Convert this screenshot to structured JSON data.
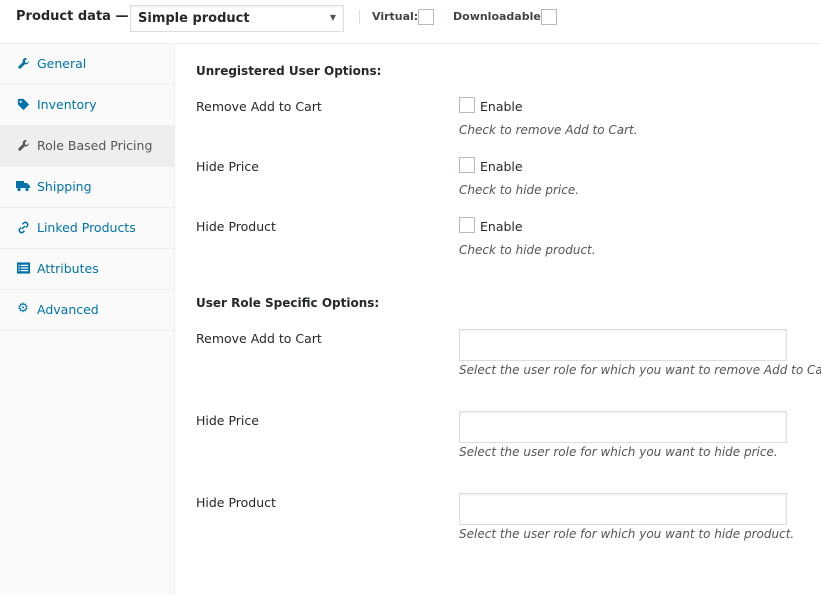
{
  "header": {
    "title": "Product data —",
    "product_type": "Simple product",
    "virtual_label": "Virtual:",
    "downloadable_label": "Downloadable:"
  },
  "sidebar": {
    "items": [
      {
        "label": "General",
        "icon": "wrench-icon"
      },
      {
        "label": "Inventory",
        "icon": "tag-icon"
      },
      {
        "label": "Role Based Pricing",
        "icon": "wrench-icon",
        "active": true
      },
      {
        "label": "Shipping",
        "icon": "truck-icon"
      },
      {
        "label": "Linked Products",
        "icon": "link-icon"
      },
      {
        "label": "Attributes",
        "icon": "list-icon"
      },
      {
        "label": "Advanced",
        "icon": "gear-icon"
      }
    ]
  },
  "unregistered": {
    "heading": "Unregistered User Options:",
    "rows": [
      {
        "label": "Remove Add to Cart",
        "checkbox_label": "Enable",
        "description": "Check to remove Add to Cart."
      },
      {
        "label": "Hide Price",
        "checkbox_label": "Enable",
        "description": "Check to hide price."
      },
      {
        "label": "Hide Product",
        "checkbox_label": "Enable",
        "description": "Check to hide product."
      }
    ]
  },
  "role_specific": {
    "heading": "User Role Specific Options:",
    "rows": [
      {
        "label": "Remove Add to Cart",
        "description": "Select the user role for which you want to remove Add to Cart."
      },
      {
        "label": "Hide Price",
        "description": "Select the user role for which you want to hide price."
      },
      {
        "label": "Hide Product",
        "description": "Select the user role for which you want to hide product."
      }
    ]
  },
  "colors": {
    "link": "#0073aa",
    "text": "#23282d",
    "border": "#eeeeee"
  }
}
